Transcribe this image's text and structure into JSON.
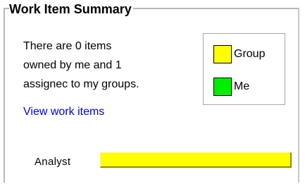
{
  "summary": {
    "title": "Work Item Summary",
    "description_lines": [
      "There are 0 items",
      "owned by me and 1",
      "assignec to my groups."
    ],
    "link_label": "View work items"
  },
  "legend": {
    "items": [
      {
        "label": "Group",
        "color": "#ffff00"
      },
      {
        "label": "Me",
        "color": "#00ee00"
      }
    ]
  },
  "bars": [
    {
      "label": "Analyst",
      "group_items": 1,
      "me_items": 0,
      "group_fraction": 1.0,
      "me_fraction": 0.0
    }
  ]
}
